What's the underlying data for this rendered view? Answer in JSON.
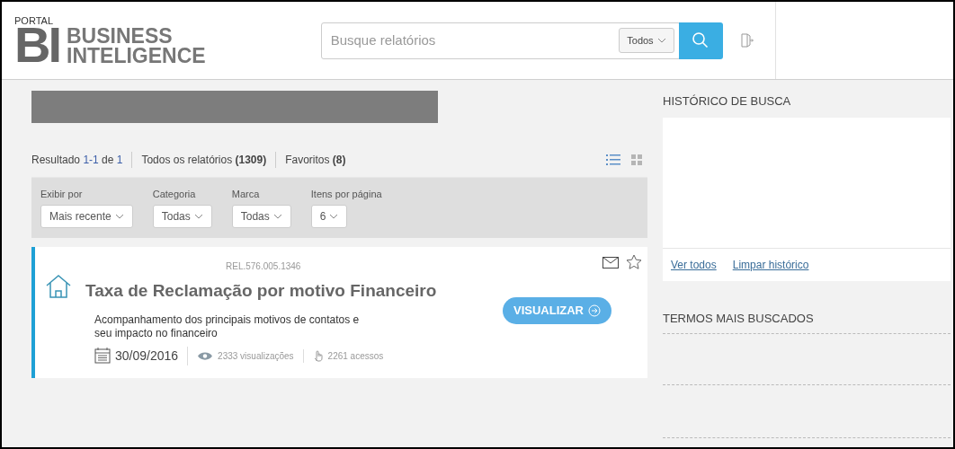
{
  "header": {
    "logo": {
      "portal": "PORTAL",
      "mark": "BI",
      "line_1": "BUSINESS",
      "line_2": "INTELIGENCE"
    },
    "search": {
      "placeholder": "Busque relatórios",
      "scope": "Todos"
    }
  },
  "results": {
    "label": "Resultado",
    "range": "1-1",
    "of": "de",
    "total": "1",
    "links": [
      "Todos os relatórios **(1309)**",
      "Favoritos **(8)**"
    ],
    "view_modes": [
      {
        "kind": "list",
        "selected": true
      },
      {
        "kind": "grid",
        "selected": false
      }
    ]
  },
  "filters": [
    {
      "label": "Exibir por",
      "value": "Mais recente"
    },
    {
      "label": "Categoria",
      "value": "Todas"
    },
    {
      "label": "Marca",
      "value": "Todas"
    },
    {
      "label": "Itens por página",
      "value": "6"
    }
  ],
  "reports": [
    {
      "code": "REL.576.005.1346",
      "title": "Taxa de Reclamação por motivo Financeiro",
      "description": "Acompanhamento dos principais motivos de contatos e seu impacto no financeiro",
      "date": "30/09/2016",
      "views": "2333 visualizações",
      "accesses": "2261 acessos",
      "button": "VISUALIZAR",
      "favorite": false
    }
  ],
  "sidebar": {
    "history_title": "HISTÓRICO DE BUSCA",
    "history_links": [
      "Ver todos",
      "Limpar histórico"
    ],
    "top_terms_title": "TERMOS MAIS BUSCADOS"
  }
}
